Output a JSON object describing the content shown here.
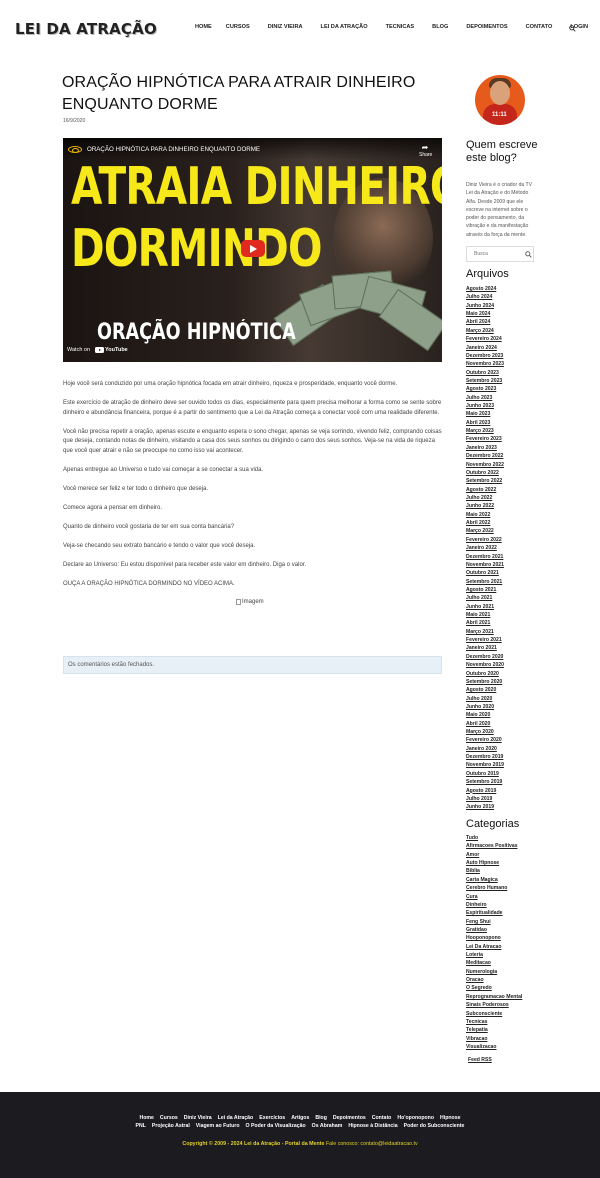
{
  "header": {
    "logo": "LEI DA ATRAÇÃO",
    "nav": [
      "Home",
      "CURSOS",
      "DINIZ VIEIRA",
      "LEI DA ATRAÇÃO",
      "TECNICAS",
      "BLOG",
      "DEPOIMENTOS",
      "CONTATO",
      "LOGIN"
    ]
  },
  "post": {
    "title": "ORAÇÃO HIPNÓTICA PARA ATRAIR DINHEIRO ENQUANTO DORME",
    "date": "16/9/2020",
    "video": {
      "title": "ORAÇÃO HIPNÓTICA PARA DINHEIRO ENQUANTO DORME",
      "share": "Share",
      "line1": "ATRAIA DINHEIRO",
      "line2": "DORMINDO",
      "line3": "ORAÇÃO HIPNÓTICA",
      "watch_on": "Watch on",
      "youtube": "YouTube"
    },
    "paragraphs": [
      "Hoje você será conduzido por uma oração hipnótica focada em atrair dinheiro, riqueza e prosperidade, enquanto você dorme.",
      "Este exercício de atração de dinheiro deve ser ouvido todos os dias, especialmente para quem precisa melhorar a forma como se sente sobre dinheiro e abundância financeira, porque é a partir do sentimento que a Lei da Atração começa a conectar você com uma realidade diferente.",
      "Você não precisa repetir a oração, apenas escute e enquanto espera o sono chegar, apenas se veja sorrindo, vivendo feliz, comprando coisas que deseja, contando notas de dinheiro, visitando a casa dos seus sonhos ou dirigindo o carro dos seus sonhos. Veja-se na vida de riqueza que você quer atrair e não se preocupe no como isso vai acontecer.",
      "Apenas entregue ao Universo e tudo vai começar a se conectar a sua vida.",
      "Você merece ser feliz e ter todo o dinheiro que deseja.",
      "Comece agora a pensar em dinheiro.",
      "Quanto de dinheiro você gostaria de ter em sua conta bancária?",
      "Veja-se checando seu extrato bancário e tendo o valor que você deseja.",
      "Declare ao Universo: Eu estou disponível para receber este valor em dinheiro. Diga o valor.",
      "OUÇA A ORAÇÃO HIPNÓTICA DORMINDO NO VÍDEO ACIMA."
    ],
    "image_alt": "Imagem",
    "comments_closed": "Os comentários estão fechados."
  },
  "sidebar": {
    "avatar_text": "11:11",
    "about_title": "Quem escreve este blog?",
    "about_text": "Diniz Vieira é o criador da TV Lei da Atração e do Método Alfa. Desde 2009 que ele escreve na internet sobre o poder do pensamento, da vibração e da manifestação através da força da mente.",
    "search_placeholder": "Busca",
    "archives_title": "Arquivos",
    "archives": [
      "Agosto 2024",
      "Julho 2024",
      "Junho 2024",
      "Maio 2024",
      "Abril 2024",
      "Março 2024",
      "Fevereiro 2024",
      "Janeiro 2024",
      "Dezembro 2023",
      "Novembro 2023",
      "Outubro 2023",
      "Setembro 2023",
      "Agosto 2023",
      "Julho 2023",
      "Junho 2023",
      "Maio 2023",
      "Abril 2023",
      "Março 2023",
      "Fevereiro 2023",
      "Janeiro 2023",
      "Dezembro 2022",
      "Novembro 2022",
      "Outubro 2022",
      "Setembro 2022",
      "Agosto 2022",
      "Julho 2022",
      "Junho 2022",
      "Maio 2022",
      "Abril 2022",
      "Março 2022",
      "Fevereiro 2022",
      "Janeiro 2022",
      "Dezembro 2021",
      "Novembro 2021",
      "Outubro 2021",
      "Setembro 2021",
      "Agosto 2021",
      "Julho 2021",
      "Junho 2021",
      "Maio 2021",
      "Abril 2021",
      "Março 2021",
      "Fevereiro 2021",
      "Janeiro 2021",
      "Dezembro 2020",
      "Novembro 2020",
      "Outubro 2020",
      "Setembro 2020",
      "Agosto 2020",
      "Julho 2020",
      "Junho 2020",
      "Maio 2020",
      "Abril 2020",
      "Março 2020",
      "Fevereiro 2020",
      "Janeiro 2020",
      "Dezembro 2019",
      "Novembro 2019",
      "Outubro 2019",
      "Setembro 2019",
      "Agosto 2019",
      "Julho 2019",
      "Junho 2019"
    ],
    "categories_title": "Categorias",
    "categories": [
      "Tudo",
      "Afirmacoes Positivas",
      "Amor",
      "Auto Hipnose",
      "Biblia",
      "Carta Magica",
      "Cerebro Humano",
      "Cura",
      "Dinheiro",
      "Espiritualidade",
      "Feng Shui",
      "Gratidao",
      "Hooponopono",
      "Lei Da Atracao",
      "Loteria",
      "Meditacao",
      "Numerologia",
      "Oracao",
      "O Segredo",
      "Reprogramacao Mental",
      "Sinais Poderosos",
      "Subconsciente",
      "Tecnicas",
      "Telepatia",
      "Vibracao",
      "Visualizacao"
    ],
    "feed": "Feed RSS"
  },
  "footer": {
    "row1": [
      "Home",
      "Cursos",
      "Diniz Vieira",
      "Lei da Atração",
      "Exercícios",
      "Artigos",
      "Blog",
      "Depoimentos",
      "Contato",
      "Ho'oponopono",
      "Hipnose"
    ],
    "row2": [
      "PNL",
      "Projeção Astral",
      "Viagem ao Futuro",
      "O Poder da Visualização",
      "Os Abraham",
      "Hipnose à Distância",
      "Poder do Subconsciente"
    ],
    "copyright": "Copyright © 2009 - 2024 Lei da Atração - Portal da Mente",
    "contact": "Fale conosco: contato@leidaatracao.tv"
  },
  "colors": {
    "accent_yellow": "#f7e81a",
    "footer_bg": "#1c1b1f",
    "copyright": "#e3d02a",
    "comments_bg": "#e8f0f7"
  }
}
